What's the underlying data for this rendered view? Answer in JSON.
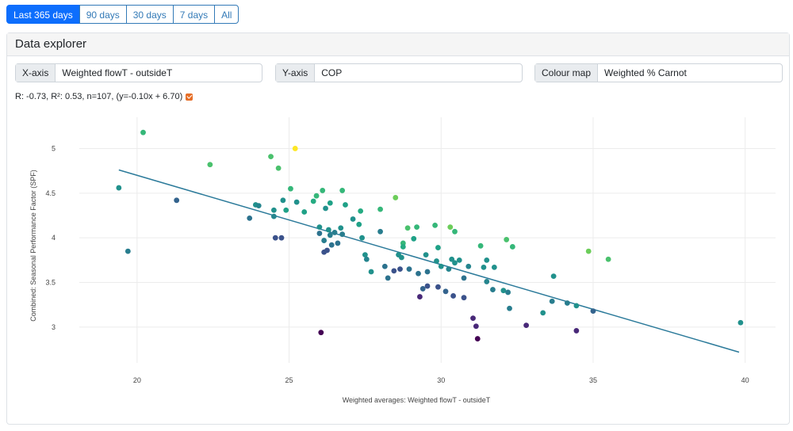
{
  "range_buttons": [
    {
      "label": "Last 365 days",
      "active": true
    },
    {
      "label": "90 days",
      "active": false
    },
    {
      "label": "30 days",
      "active": false
    },
    {
      "label": "7 days",
      "active": false
    },
    {
      "label": "All",
      "active": false
    }
  ],
  "explorer": {
    "title": "Data explorer",
    "x_axis": {
      "label": "X-axis",
      "value": "Weighted flowT - outsideT"
    },
    "y_axis": {
      "label": "Y-axis",
      "value": "COP"
    },
    "colour_map": {
      "label": "Colour map",
      "value": "Weighted % Carnot"
    },
    "stats": "R: -0.73, R²: 0.53, n=107, (y=-0.10x + 6.70)",
    "stats_checked": true
  },
  "colors": {
    "accent": "#0d6efd",
    "trendline": "#2b7a9a",
    "checkbox": "#e66e27"
  },
  "chart_data": {
    "type": "scatter",
    "xlabel": "Weighted averages: Weighted flowT - outsideT",
    "ylabel": "Combined: Seasonal Performance Factor (SPF)",
    "xlim": [
      18.1,
      41.0
    ],
    "ylim": [
      2.6,
      5.35
    ],
    "xticks": [
      20,
      25,
      30,
      35,
      40
    ],
    "yticks": [
      3,
      3.5,
      4,
      4.5,
      5
    ],
    "grid": true,
    "trendline": {
      "slope": -0.1,
      "intercept": 6.7,
      "x_range": [
        19.4,
        39.8
      ]
    },
    "points": [
      {
        "x": 20.2,
        "y": 5.18,
        "c": "#35b779"
      },
      {
        "x": 19.4,
        "y": 4.56,
        "c": "#21918c"
      },
      {
        "x": 19.7,
        "y": 3.85,
        "c": "#287d8e"
      },
      {
        "x": 21.3,
        "y": 4.42,
        "c": "#33638d"
      },
      {
        "x": 22.4,
        "y": 4.82,
        "c": "#4ac16d"
      },
      {
        "x": 23.7,
        "y": 4.22,
        "c": "#2c728e"
      },
      {
        "x": 23.9,
        "y": 4.37,
        "c": "#21918c"
      },
      {
        "x": 24.0,
        "y": 4.36,
        "c": "#25858e"
      },
      {
        "x": 24.4,
        "y": 4.91,
        "c": "#4ac16d"
      },
      {
        "x": 24.5,
        "y": 4.31,
        "c": "#21918c"
      },
      {
        "x": 24.5,
        "y": 4.24,
        "c": "#25858e"
      },
      {
        "x": 24.55,
        "y": 4.0,
        "c": "#3b528b"
      },
      {
        "x": 24.65,
        "y": 4.78,
        "c": "#4ac16d"
      },
      {
        "x": 24.75,
        "y": 4.0,
        "c": "#3b528b"
      },
      {
        "x": 24.8,
        "y": 4.42,
        "c": "#21918c"
      },
      {
        "x": 24.9,
        "y": 4.31,
        "c": "#1fa187"
      },
      {
        "x": 25.05,
        "y": 4.55,
        "c": "#35b779"
      },
      {
        "x": 25.2,
        "y": 5.0,
        "c": "#fde725"
      },
      {
        "x": 25.25,
        "y": 4.4,
        "c": "#21918c"
      },
      {
        "x": 25.5,
        "y": 4.29,
        "c": "#1fa187"
      },
      {
        "x": 25.8,
        "y": 4.41,
        "c": "#25ab82"
      },
      {
        "x": 25.9,
        "y": 4.47,
        "c": "#35b779"
      },
      {
        "x": 26.0,
        "y": 4.12,
        "c": "#21918c"
      },
      {
        "x": 26.0,
        "y": 4.05,
        "c": "#2c728e"
      },
      {
        "x": 26.05,
        "y": 2.94,
        "c": "#440154"
      },
      {
        "x": 26.1,
        "y": 4.53,
        "c": "#35b779"
      },
      {
        "x": 26.15,
        "y": 3.97,
        "c": "#287d8e"
      },
      {
        "x": 26.15,
        "y": 3.84,
        "c": "#3b528b"
      },
      {
        "x": 26.2,
        "y": 4.33,
        "c": "#21918c"
      },
      {
        "x": 26.25,
        "y": 3.86,
        "c": "#3b528b"
      },
      {
        "x": 26.3,
        "y": 4.09,
        "c": "#21918c"
      },
      {
        "x": 26.35,
        "y": 4.03,
        "c": "#287d8e"
      },
      {
        "x": 26.35,
        "y": 4.39,
        "c": "#1fa187"
      },
      {
        "x": 26.4,
        "y": 3.92,
        "c": "#2c728e"
      },
      {
        "x": 26.5,
        "y": 4.06,
        "c": "#287d8e"
      },
      {
        "x": 26.6,
        "y": 3.94,
        "c": "#2c728e"
      },
      {
        "x": 26.7,
        "y": 4.11,
        "c": "#21918c"
      },
      {
        "x": 26.75,
        "y": 4.53,
        "c": "#35b779"
      },
      {
        "x": 26.75,
        "y": 4.04,
        "c": "#287d8e"
      },
      {
        "x": 26.85,
        "y": 4.37,
        "c": "#1fa187"
      },
      {
        "x": 27.1,
        "y": 4.21,
        "c": "#21918c"
      },
      {
        "x": 27.3,
        "y": 4.15,
        "c": "#1fa187"
      },
      {
        "x": 27.35,
        "y": 4.3,
        "c": "#25ab82"
      },
      {
        "x": 27.4,
        "y": 4.0,
        "c": "#21918c"
      },
      {
        "x": 27.5,
        "y": 3.81,
        "c": "#21918c"
      },
      {
        "x": 27.55,
        "y": 3.76,
        "c": "#25858e"
      },
      {
        "x": 27.7,
        "y": 3.62,
        "c": "#21918c"
      },
      {
        "x": 28.0,
        "y": 4.32,
        "c": "#35b779"
      },
      {
        "x": 28.0,
        "y": 4.07,
        "c": "#287d8e"
      },
      {
        "x": 28.15,
        "y": 3.68,
        "c": "#2c728e"
      },
      {
        "x": 28.25,
        "y": 3.55,
        "c": "#2c728e"
      },
      {
        "x": 28.45,
        "y": 3.63,
        "c": "#3b528b"
      },
      {
        "x": 28.5,
        "y": 4.45,
        "c": "#6ccd5a"
      },
      {
        "x": 28.6,
        "y": 3.81,
        "c": "#21918c"
      },
      {
        "x": 28.65,
        "y": 3.65,
        "c": "#3b528b"
      },
      {
        "x": 28.7,
        "y": 3.78,
        "c": "#21918c"
      },
      {
        "x": 28.75,
        "y": 3.94,
        "c": "#35b779"
      },
      {
        "x": 28.75,
        "y": 3.9,
        "c": "#25ab82"
      },
      {
        "x": 28.9,
        "y": 4.11,
        "c": "#4ac16d"
      },
      {
        "x": 28.95,
        "y": 3.65,
        "c": "#2c728e"
      },
      {
        "x": 29.1,
        "y": 3.99,
        "c": "#1fa187"
      },
      {
        "x": 29.2,
        "y": 4.12,
        "c": "#35b779"
      },
      {
        "x": 29.25,
        "y": 3.6,
        "c": "#2c728e"
      },
      {
        "x": 29.3,
        "y": 3.34,
        "c": "#482878"
      },
      {
        "x": 29.4,
        "y": 3.43,
        "c": "#33638d"
      },
      {
        "x": 29.5,
        "y": 3.81,
        "c": "#21918c"
      },
      {
        "x": 29.55,
        "y": 3.62,
        "c": "#2c728e"
      },
      {
        "x": 29.55,
        "y": 3.46,
        "c": "#3b528b"
      },
      {
        "x": 29.8,
        "y": 4.14,
        "c": "#35b779"
      },
      {
        "x": 29.85,
        "y": 3.74,
        "c": "#21918c"
      },
      {
        "x": 29.9,
        "y": 3.89,
        "c": "#1fa187"
      },
      {
        "x": 29.9,
        "y": 3.45,
        "c": "#3b528b"
      },
      {
        "x": 30.0,
        "y": 3.68,
        "c": "#21918c"
      },
      {
        "x": 30.15,
        "y": 3.4,
        "c": "#33638d"
      },
      {
        "x": 30.25,
        "y": 3.65,
        "c": "#25858e"
      },
      {
        "x": 30.3,
        "y": 4.12,
        "c": "#6ccd5a"
      },
      {
        "x": 30.35,
        "y": 3.76,
        "c": "#21918c"
      },
      {
        "x": 30.4,
        "y": 3.35,
        "c": "#3b528b"
      },
      {
        "x": 30.45,
        "y": 4.07,
        "c": "#35b779"
      },
      {
        "x": 30.45,
        "y": 3.72,
        "c": "#21918c"
      },
      {
        "x": 30.6,
        "y": 3.75,
        "c": "#21918c"
      },
      {
        "x": 30.75,
        "y": 3.33,
        "c": "#3b528b"
      },
      {
        "x": 30.75,
        "y": 3.55,
        "c": "#2c728e"
      },
      {
        "x": 30.9,
        "y": 3.68,
        "c": "#25858e"
      },
      {
        "x": 31.05,
        "y": 3.1,
        "c": "#482878"
      },
      {
        "x": 31.15,
        "y": 3.01,
        "c": "#482878"
      },
      {
        "x": 31.2,
        "y": 2.87,
        "c": "#440154"
      },
      {
        "x": 31.3,
        "y": 3.91,
        "c": "#35b779"
      },
      {
        "x": 31.4,
        "y": 3.67,
        "c": "#21918c"
      },
      {
        "x": 31.5,
        "y": 3.51,
        "c": "#25858e"
      },
      {
        "x": 31.5,
        "y": 3.75,
        "c": "#21918c"
      },
      {
        "x": 31.7,
        "y": 3.42,
        "c": "#287d8e"
      },
      {
        "x": 31.75,
        "y": 3.67,
        "c": "#21918c"
      },
      {
        "x": 32.05,
        "y": 3.41,
        "c": "#21918c"
      },
      {
        "x": 32.15,
        "y": 3.98,
        "c": "#4ac16d"
      },
      {
        "x": 32.2,
        "y": 3.39,
        "c": "#287d8e"
      },
      {
        "x": 32.25,
        "y": 3.21,
        "c": "#287d8e"
      },
      {
        "x": 32.35,
        "y": 3.9,
        "c": "#35b779"
      },
      {
        "x": 32.8,
        "y": 3.02,
        "c": "#482878"
      },
      {
        "x": 33.35,
        "y": 3.16,
        "c": "#21918c"
      },
      {
        "x": 33.65,
        "y": 3.29,
        "c": "#287d8e"
      },
      {
        "x": 33.7,
        "y": 3.57,
        "c": "#21918c"
      },
      {
        "x": 34.15,
        "y": 3.27,
        "c": "#287d8e"
      },
      {
        "x": 34.45,
        "y": 3.24,
        "c": "#21918c"
      },
      {
        "x": 34.45,
        "y": 2.96,
        "c": "#482878"
      },
      {
        "x": 34.85,
        "y": 3.85,
        "c": "#6ccd5a"
      },
      {
        "x": 35.0,
        "y": 3.18,
        "c": "#33638d"
      },
      {
        "x": 35.5,
        "y": 3.76,
        "c": "#4ac16d"
      },
      {
        "x": 39.85,
        "y": 3.05,
        "c": "#21918c"
      }
    ]
  }
}
